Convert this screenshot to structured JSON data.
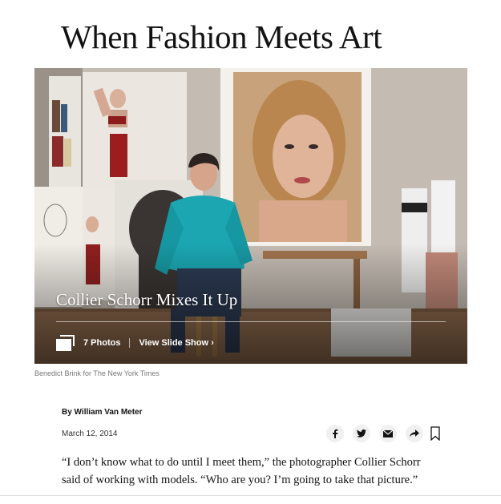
{
  "article": {
    "headline": "When Fashion Meets Art",
    "byline": "By William Van Meter",
    "date": "March 12, 2014",
    "body_first_paragraph": "“I don’t know what to do until I meet them,” the photographer Collier Schorr said of working with models. “Who are you? I’m going to take that picture.”"
  },
  "slideshow": {
    "title": "Collier Schorr Mixes It Up",
    "photo_count": "7 Photos",
    "view_label": "View Slide Show ›",
    "photos_icon": "photos-stack-icon"
  },
  "photo": {
    "credit": "Benedict Brink for The New York Times"
  },
  "share": {
    "icons": [
      "facebook-icon",
      "twitter-icon",
      "email-icon",
      "share-arrow-icon",
      "bookmark-icon"
    ]
  },
  "colors": {
    "text": "#121212",
    "caption": "#777777",
    "share_bg": "#f0f0f0",
    "sweater": "#1aa6b0"
  }
}
